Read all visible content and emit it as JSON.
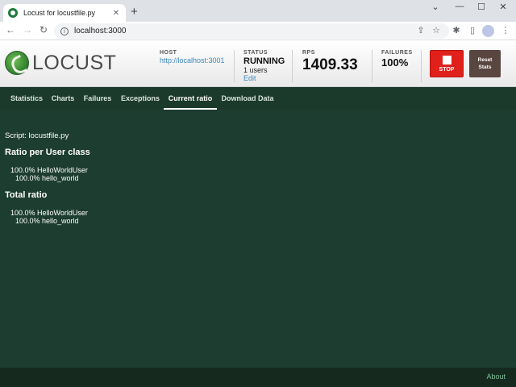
{
  "browser": {
    "tab_title": "Locust for locustfile.py",
    "tab_close": "✕",
    "new_tab": "+",
    "url": "localhost:3000",
    "controls": {
      "minimize": "—",
      "maximize": "☐",
      "close": "✕",
      "chevron": "⌄"
    }
  },
  "header": {
    "logo_text": "LOCUST",
    "host_label": "HOST",
    "host_value": "http://localhost:3001",
    "status_label": "STATUS",
    "status_value": "RUNNING",
    "users": "1 users",
    "edit": "Edit",
    "rps_label": "RPS",
    "rps_value": "1409.33",
    "failures_label": "FAILURES",
    "failures_value": "100%",
    "stop_label": "STOP",
    "reset_line1": "Reset",
    "reset_line2": "Stats"
  },
  "nav": {
    "tabs": [
      {
        "label": "Statistics"
      },
      {
        "label": "Charts"
      },
      {
        "label": "Failures"
      },
      {
        "label": "Exceptions"
      },
      {
        "label": "Current ratio"
      },
      {
        "label": "Download Data"
      }
    ],
    "active": "Current ratio"
  },
  "main": {
    "script": "Script: locustfile.py",
    "ratio_per_class_title": "Ratio per User class",
    "ratio_per_class": [
      {
        "text": "100.0% HelloWorldUser"
      },
      {
        "text": "100.0% hello_world"
      }
    ],
    "total_title": "Total ratio",
    "total": [
      {
        "text": "100.0% HelloWorldUser"
      },
      {
        "text": "100.0% hello_world"
      }
    ]
  },
  "footer": {
    "about": "About"
  },
  "colors": {
    "header_bg": "#f2f2f2",
    "nav_bg": "#1c3a2c",
    "main_bg": "#1d3d30",
    "footer_bg": "#15291f",
    "stop_red": "#e0201b",
    "reset_brown": "#5a4641",
    "link_blue": "#3d88b8",
    "about_green": "#7dc197"
  }
}
